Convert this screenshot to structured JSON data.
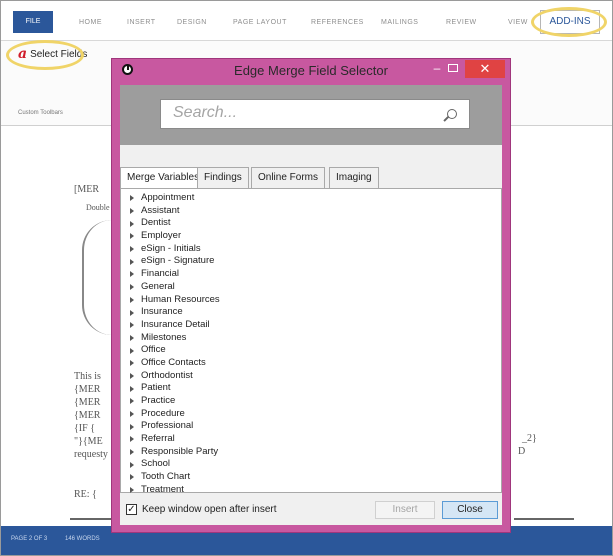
{
  "ribbon": {
    "tabs": [
      "FILE",
      "HOME",
      "INSERT",
      "DESIGN",
      "PAGE LAYOUT",
      "REFERENCES",
      "MAILINGS",
      "REVIEW",
      "VIEW",
      "ADD-INS"
    ],
    "select_fields_label": "Select Fields",
    "group_label": "Custom Toolbars"
  },
  "document": {
    "lines": [
      "[MER",
      "Double",
      "This is",
      "{MER",
      "{MER",
      "{MER",
      "{IF {",
      "\"}{ME",
      "requesty",
      "RE: {",
      "_2}",
      "D"
    ]
  },
  "statusbar": {
    "page": "PAGE 2 OF 3",
    "words": "146 WORDS"
  },
  "dialog": {
    "title": "Edge Merge Field Selector",
    "search_placeholder": "Search...",
    "tabs": [
      "Merge Variables",
      "Findings",
      "Online Forms",
      "Imaging"
    ],
    "active_tab": "Merge Variables",
    "tree_items": [
      "Appointment",
      "Assistant",
      "Dentist",
      "Employer",
      "eSign - Initials",
      "eSign - Signature",
      "Financial",
      "General",
      "Human Resources",
      "Insurance",
      "Insurance Detail",
      "Milestones",
      "Office",
      "Office Contacts",
      "Orthodontist",
      "Patient",
      "Practice",
      "Procedure",
      "Professional",
      "Referral",
      "Responsible Party",
      "School",
      "Tooth Chart",
      "Treatment"
    ],
    "keep_open_label": "Keep window open after insert",
    "keep_open_checked": true,
    "insert_label": "Insert",
    "close_label": "Close",
    "checkmark": "✓",
    "min_glyph": "–",
    "close_glyph": "✕"
  },
  "colors": {
    "dialog_frame": "#c858a0",
    "word_blue": "#2b579a",
    "highlight": "#f0d468",
    "close_red": "#e04343"
  }
}
